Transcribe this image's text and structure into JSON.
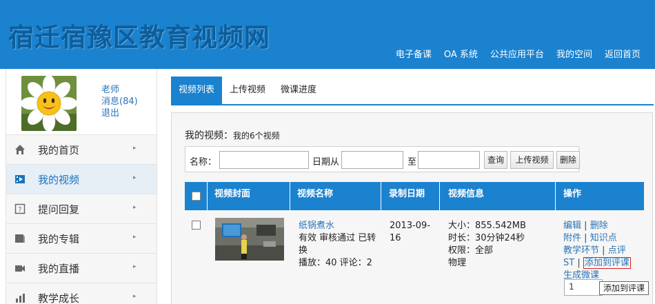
{
  "site": {
    "title": "宿迁宿豫区教育视频网",
    "nav": [
      "电子备课",
      "OA 系统",
      "公共应用平台",
      "我的空间",
      "返回首页"
    ]
  },
  "profile": {
    "role_link": "老师",
    "messages_link": "消息(84)",
    "logout_link": "退出"
  },
  "sidebar": {
    "items": [
      {
        "label": "我的首页",
        "icon": "home-icon",
        "active": false
      },
      {
        "label": "我的视频",
        "icon": "video-icon",
        "active": true
      },
      {
        "label": "提问回复",
        "icon": "question-icon",
        "active": false
      },
      {
        "label": "我的专辑",
        "icon": "album-icon",
        "active": false
      },
      {
        "label": "我的直播",
        "icon": "camera-icon",
        "active": false
      },
      {
        "label": "教学成长",
        "icon": "chart-icon",
        "active": false
      }
    ]
  },
  "tabs": [
    {
      "label": "视频列表",
      "active": true
    },
    {
      "label": "上传视频",
      "active": false
    },
    {
      "label": "微课进度",
      "active": false
    }
  ],
  "panel": {
    "title": "我的视频：",
    "subtitle": "我的6个视频"
  },
  "search": {
    "name_label": "名称：",
    "date_from_label": "日期从",
    "date_to_label": "至",
    "query_btn": "查询",
    "upload_btn": "上传视频",
    "delete_btn": "删除"
  },
  "table": {
    "headers": [
      "视频封面",
      "视频名称",
      "录制日期",
      "视频信息",
      "操作"
    ],
    "rows": [
      {
        "name": "纸锅煮水",
        "status": "有效 审核通过 已转换",
        "stats": "播放：40 评论：2",
        "date": "2013-09-16",
        "size": "大小：855.542MB",
        "duration": "时长：30分钟24秒",
        "permission": "权限：全部",
        "subject": "物理",
        "ops": {
          "edit": "编辑",
          "delete": "删除",
          "attachment": "附件",
          "knowledge": "知识点",
          "step": "教学环节",
          "comment": "点评",
          "st": "ST",
          "add_eval": "添加到评课",
          "gen_micro": "生成微课"
        },
        "qty": "1"
      }
    ]
  },
  "tooltip": "添加到评课",
  "colors": {
    "primary": "#1b82cf",
    "link": "#2a74b8",
    "highlight": "#d21f1f"
  }
}
